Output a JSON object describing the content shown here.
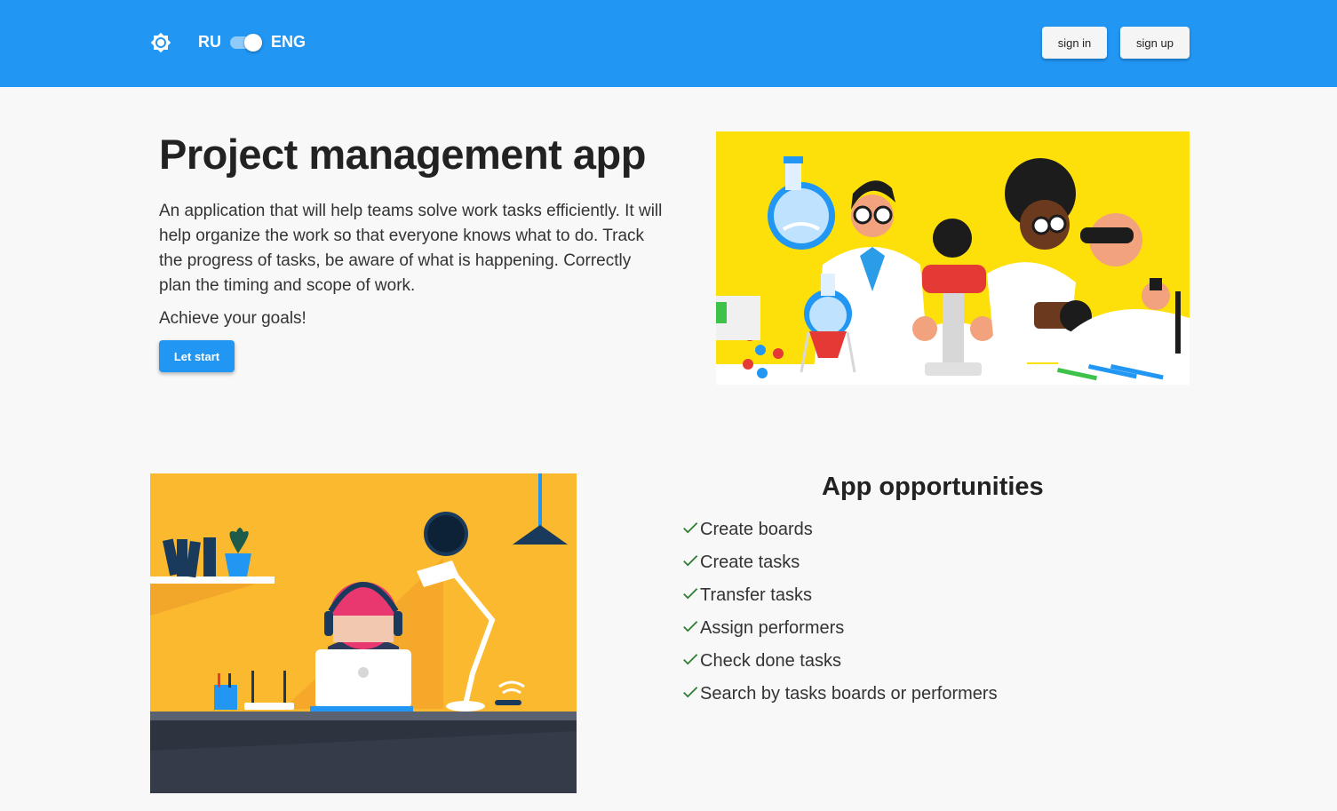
{
  "header": {
    "theme_icon": "brightness-icon",
    "lang_left": "RU",
    "lang_right": "ENG",
    "lang_toggle_state": "ENG",
    "sign_in_label": "sign in",
    "sign_up_label": "sign up",
    "bg_color": "#2196f3"
  },
  "hero": {
    "title": "Project management app",
    "description": "An application that will help teams solve work tasks efficiently. It will help organize the work so that everyone knows what to do. Track the progress of tasks, be aware of what is happening. Correctly plan the timing and scope of work.",
    "goal": "Achieve your goals!",
    "cta_label": "Let start",
    "image": "scientists-lab-illustration"
  },
  "opportunities": {
    "title": "App opportunities",
    "image": "person-working-at-laptop-illustration",
    "check_icon": "check-icon",
    "check_color": "#2e7d32",
    "items": [
      "Create boards",
      "Create tasks",
      "Transfer tasks",
      "Assign performers",
      "Check done tasks",
      "Search by tasks boards or performers"
    ]
  }
}
